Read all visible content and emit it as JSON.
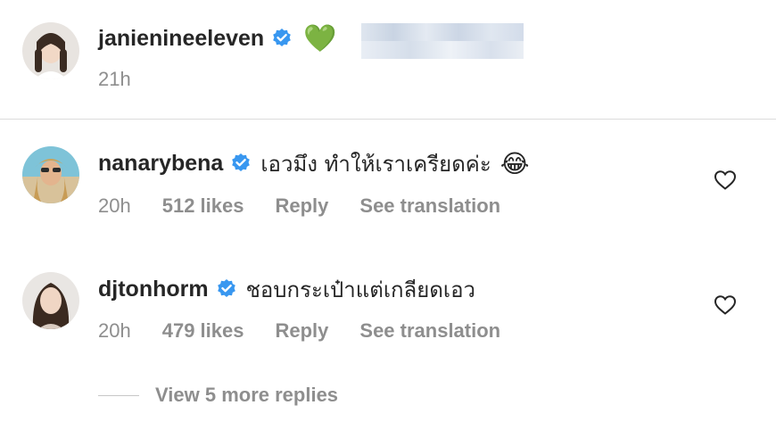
{
  "post": {
    "username": "janienineeleven",
    "emoji": "💚",
    "time": "21h"
  },
  "comments": [
    {
      "username": "nanarybena",
      "text": "เอวมึง ทำให้เราเครียดค่ะ",
      "emoji": "😂",
      "time": "20h",
      "likes": "512 likes",
      "reply": "Reply",
      "translate": "See translation"
    },
    {
      "username": "djtonhorm",
      "text": "ชอบกระเป๋าแต่เกลียดเอว",
      "time": "20h",
      "likes": "479 likes",
      "reply": "Reply",
      "translate": "See translation"
    }
  ],
  "view_more": "View 5 more replies",
  "colors": {
    "text": "#262626",
    "secondary": "#8e8e8e",
    "verified": "#3897f0",
    "divider": "#dbdbdb"
  },
  "icons": [
    "verified-badge-icon",
    "heart-icon"
  ]
}
